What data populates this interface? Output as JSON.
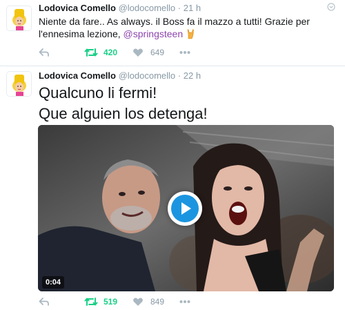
{
  "colors": {
    "text": "#14171a",
    "meta": "#8899a6",
    "mention": "#8e44ad",
    "retweeted": "#19cf86",
    "play": "#1b95e0",
    "divider": "#e1e8ed"
  },
  "tweets": [
    {
      "author_name": "Lodovica Comello",
      "author_handle": "@lodocomello",
      "dot": "·",
      "time": "21 h",
      "text_part1": "Niente da fare.. As always. il Boss fa il mazzo a tutti! Grazie per l'ennesima lezione, ",
      "mention": "@springsteen",
      "emoji_icon": "horns-hand-emoji",
      "retweets": "420",
      "likes": "649",
      "retweeted": true
    },
    {
      "author_name": "Lodovica Comello",
      "author_handle": "@lodocomello",
      "dot": "·",
      "time": "22 h",
      "text_line1": "Qualcuno li fermi!",
      "text_line2": "Que alguien los detenga!",
      "video_duration": "0:04",
      "retweets": "519",
      "likes": "849",
      "retweeted": true
    }
  ],
  "icons": {
    "reply": "reply-icon",
    "retweet": "retweet-icon",
    "like": "heart-icon",
    "more": "more-dots-icon",
    "caret": "caret-down-icon",
    "play": "play-icon"
  }
}
